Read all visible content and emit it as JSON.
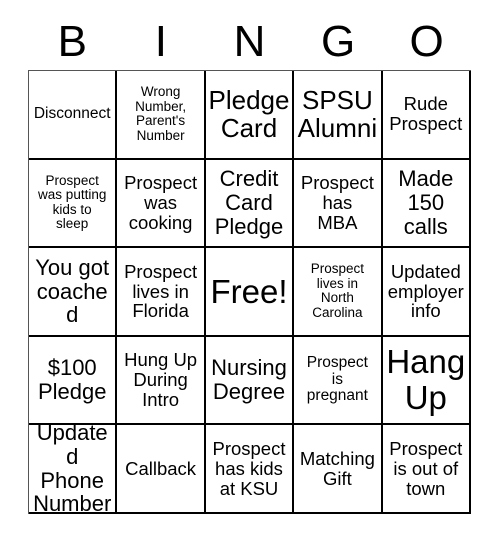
{
  "card": {
    "title_letters": [
      "B",
      "I",
      "N",
      "G",
      "O"
    ],
    "free_space_label": "Free!",
    "rows": [
      [
        {
          "text": "Disconnect",
          "size": "s-sm"
        },
        {
          "text": "Wrong\nNumber,\nParent's\nNumber",
          "size": "s-xs"
        },
        {
          "text": "Pledge\nCard",
          "size": "s-xl"
        },
        {
          "text": "SPSU\nAlumni",
          "size": "s-xl"
        },
        {
          "text": "Rude\nProspect",
          "size": "s-md"
        }
      ],
      [
        {
          "text": "Prospect\nwas putting\nkids to\nsleep",
          "size": "s-xs"
        },
        {
          "text": "Prospect\nwas\ncooking",
          "size": "s-md"
        },
        {
          "text": "Credit\nCard\nPledge",
          "size": "s-lg"
        },
        {
          "text": "Prospect\nhas\nMBA",
          "size": "s-md"
        },
        {
          "text": "Made\n150\ncalls",
          "size": "s-lg"
        }
      ],
      [
        {
          "text": "You got\ncoached",
          "size": "s-lg"
        },
        {
          "text": "Prospect\nlives in\nFlorida",
          "size": "s-md"
        },
        {
          "text": "Free!",
          "size": "s-xxl"
        },
        {
          "text": "Prospect\nlives in\nNorth\nCarolina",
          "size": "s-xs"
        },
        {
          "text": "Updated\nemployer\ninfo",
          "size": "s-md"
        }
      ],
      [
        {
          "text": "$100\nPledge",
          "size": "s-lg"
        },
        {
          "text": "Hung Up\nDuring\nIntro",
          "size": "s-md"
        },
        {
          "text": "Nursing\nDegree",
          "size": "s-lg"
        },
        {
          "text": "Prospect\nis\npregnant",
          "size": "s-sm"
        },
        {
          "text": "Hang\nUp",
          "size": "s-xxl"
        }
      ],
      [
        {
          "text": "Updated\nPhone\nNumber",
          "size": "s-lg"
        },
        {
          "text": "Callback",
          "size": "s-md"
        },
        {
          "text": "Prospect\nhas kids\nat KSU",
          "size": "s-md"
        },
        {
          "text": "Matching\nGift",
          "size": "s-md"
        },
        {
          "text": "Prospect\nis out of\ntown",
          "size": "s-md"
        }
      ]
    ],
    "colors": {
      "background": "#ffffff",
      "text": "#000000",
      "border": "#000000"
    }
  }
}
